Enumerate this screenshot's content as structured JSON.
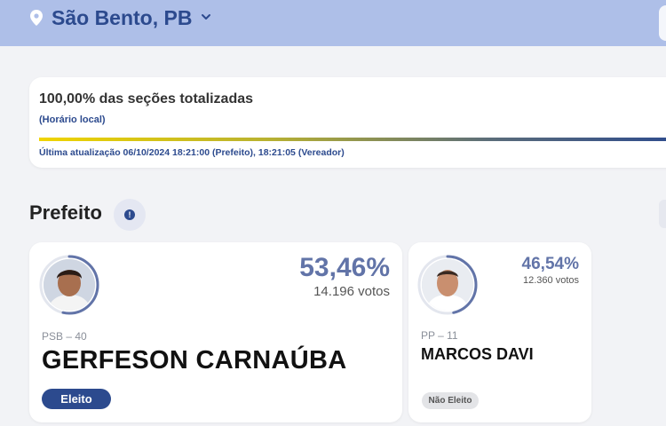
{
  "header": {
    "location": "São Bento, PB",
    "icons": {
      "location": "map-pin-icon",
      "dropdown": "chevron-down-icon"
    }
  },
  "totalization": {
    "title": "100,00% das seções totalizadas",
    "subtitle": "(Horário local)",
    "progress_percent": 100,
    "last_update": "Última atualização 06/10/2024 18:21:00 (Prefeito), 18:21:05 (Vereador)"
  },
  "section": {
    "title": "Prefeito",
    "info_icon": "!"
  },
  "candidates": [
    {
      "party": "PSB – 40",
      "name": "GERFESON CARNAÚBA",
      "percent": "53,46%",
      "votes": "14.196 votos",
      "status": "Eleito",
      "vote_share": 0.5346
    },
    {
      "party": "PP – 11",
      "name": "MARCOS DAVI",
      "percent": "46,54%",
      "votes": "12.360 votos",
      "status": "Não Eleito",
      "vote_share": 0.4654
    }
  ],
  "colors": {
    "topbar": "#aebfe8",
    "brand_blue": "#2c4a8e",
    "percent_text": "#6274a8",
    "progress_start": "#f0d400"
  }
}
